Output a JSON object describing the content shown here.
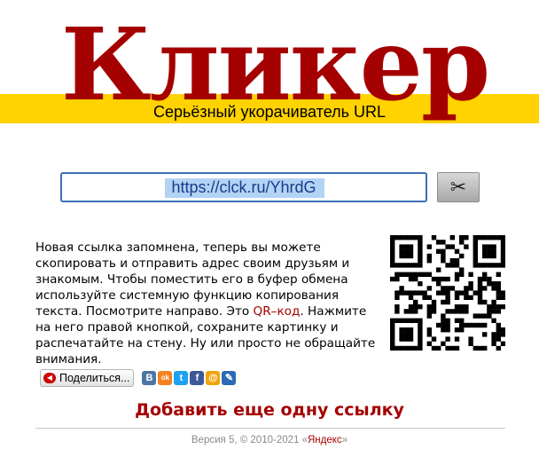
{
  "header": {
    "logo": "Кликер",
    "tagline": "Серьёзный укорачиватель URL"
  },
  "shortener": {
    "url_value": "https://clck.ru/YhrdG",
    "cut_button_icon": "scissors-icon"
  },
  "message": {
    "text_before": "Новая ссылка запомнена, теперь вы можете скопировать и отправить адрес своим друзьям и знакомым. Чтобы поместить его в буфер обмена используйте системную функцию копирования текста. Посмотрите направо. Это ",
    "qr_link": "QR–код",
    "text_after": ". Нажмите на него правой кнопкой, сохраните картинку и распечатайте на стену. Ну или просто не обращайте внимания."
  },
  "share": {
    "button_label": "Поделиться...",
    "icons": [
      {
        "name": "vk-icon",
        "letter": "В",
        "color": "#4c75a3"
      },
      {
        "name": "odnoklassniki-icon",
        "letter": "ok",
        "color": "#f58220"
      },
      {
        "name": "twitter-icon",
        "letter": "t",
        "color": "#1da1f2"
      },
      {
        "name": "facebook-icon",
        "letter": "f",
        "color": "#3b5998"
      },
      {
        "name": "mailru-icon",
        "letter": "@",
        "color": "#f0a30a"
      },
      {
        "name": "livejournal-icon",
        "letter": "✎",
        "color": "#2c6bb5"
      }
    ]
  },
  "actions": {
    "add_link": "Добавить еще одну ссылку"
  },
  "footer": {
    "version_text": "Версия 5, © 2010-2021 «",
    "company": "Яндекс",
    "closing": "»"
  },
  "colors": {
    "brand_red": "#a50000",
    "band_yellow": "#ffd200",
    "input_border": "#3c6fb6"
  }
}
